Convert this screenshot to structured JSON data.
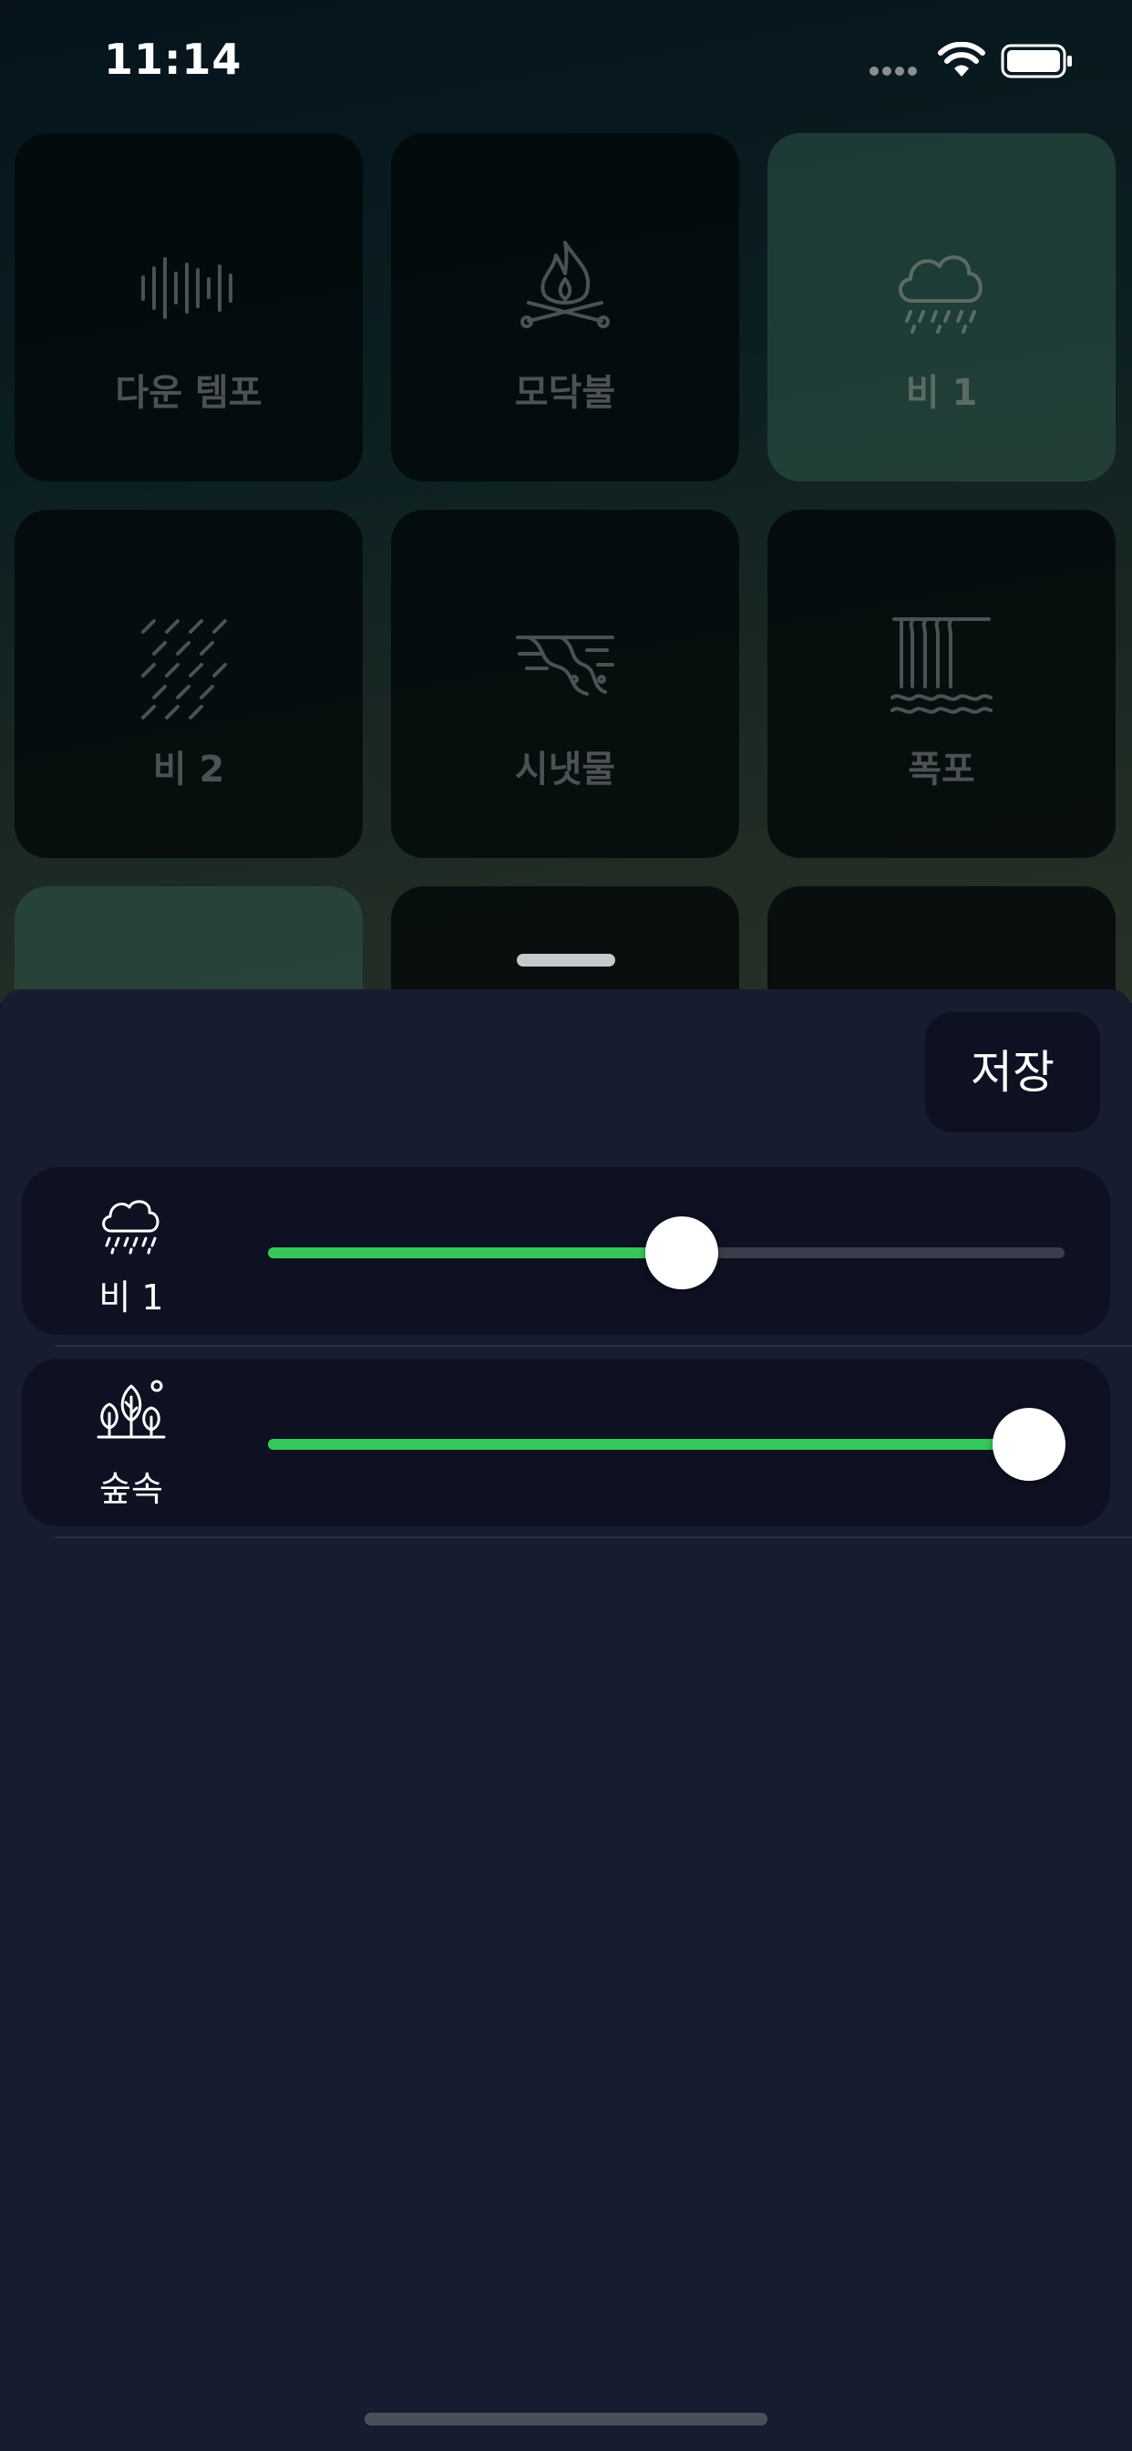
{
  "status_bar": {
    "time": "11:14"
  },
  "grid": {
    "tiles": [
      {
        "label": "다운 템포",
        "icon": "soundwave-icon",
        "active": false
      },
      {
        "label": "모닥불",
        "icon": "campfire-icon",
        "active": false
      },
      {
        "label": "비 1",
        "icon": "rain-cloud-icon",
        "active": true
      },
      {
        "label": "비 2",
        "icon": "rain-lines-icon",
        "active": false
      },
      {
        "label": "시냇물",
        "icon": "stream-icon",
        "active": false
      },
      {
        "label": "폭포",
        "icon": "waterfall-icon",
        "active": false
      }
    ]
  },
  "sheet": {
    "save_label": "저장",
    "mixer": [
      {
        "label": "비 1",
        "icon": "rain-cloud-icon",
        "volume": 0.52
      },
      {
        "label": "숲속",
        "icon": "forest-icon",
        "volume": 0.955
      }
    ]
  },
  "colors": {
    "accent": "#34c85a",
    "sheet_bg": "#181c30",
    "row_bg": "#0e1121"
  }
}
